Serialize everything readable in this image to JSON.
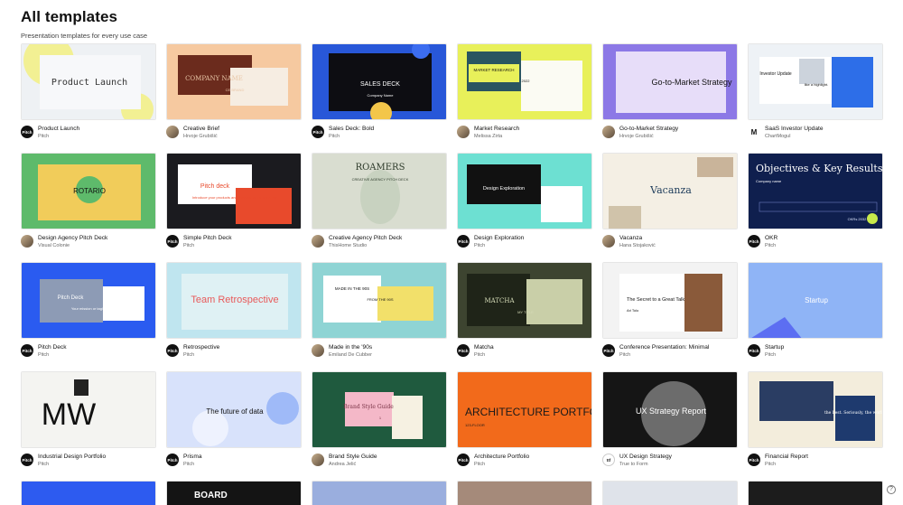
{
  "header": {
    "title": "All templates",
    "subtitle": "Presentation templates for every use case"
  },
  "help": {
    "icon": "question-icon",
    "glyph": "?"
  },
  "cards": [
    {
      "title": "Product Launch",
      "author": "Pitch",
      "avatar": "Pitch",
      "thumb_text": "Product Launch",
      "thumb_small": "",
      "thumb_extra": "",
      "bg": "#eef1f4",
      "accent": "#f3f06a"
    },
    {
      "title": "Creative Brief",
      "author": "Hrvoje Grubišić",
      "avatar": "",
      "thumb_text": "COMPANY NAME",
      "thumb_small": "CE BRAND",
      "thumb_extra": "",
      "bg": "#f6c9a0",
      "accent": "#6b2b1d"
    },
    {
      "title": "Sales Deck: Bold",
      "author": "Pitch",
      "avatar": "Pitch",
      "thumb_text": "SALES DECK",
      "thumb_small": "Company Name",
      "thumb_extra": "",
      "bg": "#2857d8",
      "accent": "#0d0d12"
    },
    {
      "title": "Market Research",
      "author": "Melissa Zirta",
      "avatar": "",
      "thumb_text": "MARKET RESEARCH",
      "thumb_small": "2022",
      "thumb_extra": "",
      "bg": "#e8f05a",
      "accent": "#2a5560"
    },
    {
      "title": "Go-to-Market Strategy",
      "author": "Hrvoje Grubišić",
      "avatar": "",
      "thumb_text": "Go-to-Market Strategy",
      "thumb_small": "",
      "thumb_extra": "",
      "bg": "#8c78e6",
      "accent": "#ffffff"
    },
    {
      "title": "SaaS Investor Update",
      "author": "ChartMogul",
      "avatar": "M",
      "thumb_text": "Investor Update",
      "thumb_small": "like a highlight.",
      "thumb_extra": "",
      "bg": "#eef2f6",
      "accent": "#2d6ee8"
    },
    {
      "title": "Design Agency Pitch Deck",
      "author": "Visual Colonie",
      "avatar": "",
      "thumb_text": "ROTARIO",
      "thumb_small": "",
      "thumb_extra": "",
      "bg": "#5eba6b",
      "accent": "#f1cc5a"
    },
    {
      "title": "Simple Pitch Deck",
      "author": "Pitch",
      "avatar": "Pitch",
      "thumb_text": "Pitch deck",
      "thumb_small": "Introduce your products and services to the customer",
      "thumb_extra": "",
      "bg": "#1b1b1f",
      "accent": "#e84a2c"
    },
    {
      "title": "Creative Agency Pitch Deck",
      "author": "ThisHome Studio",
      "avatar": "",
      "thumb_text": "ROAMERS",
      "thumb_small": "CREATIVE AGENCY PITCH DECK",
      "thumb_extra": "",
      "bg": "#d9ddd0",
      "accent": "#5a6a52"
    },
    {
      "title": "Design Exploration",
      "author": "Pitch",
      "avatar": "Pitch",
      "thumb_text": "Design Exploration",
      "thumb_small": "",
      "thumb_extra": "",
      "bg": "#6de0d2",
      "accent": "#111111"
    },
    {
      "title": "Vacanza",
      "author": "Hana Stojaković",
      "avatar": "",
      "thumb_text": "Vacanza",
      "thumb_small": "",
      "thumb_extra": "",
      "bg": "#f4efe4",
      "accent": "#1d3b5a"
    },
    {
      "title": "OKR",
      "author": "Pitch",
      "avatar": "Pitch",
      "thumb_text": "Objectives & Key Results",
      "thumb_small": "Company name",
      "thumb_extra": "OKRs 2032",
      "bg": "#0f1f4e",
      "accent": "#c8ea4b"
    },
    {
      "title": "Pitch Deck",
      "author": "Pitch",
      "avatar": "Pitch",
      "thumb_text": "Pitch Deck",
      "thumb_small": "Your mission or tagline",
      "thumb_extra": "",
      "bg": "#2a5bf0",
      "accent": "#ffffff"
    },
    {
      "title": "Retrospective",
      "author": "Pitch",
      "avatar": "Pitch",
      "thumb_text": "Team Retrospective",
      "thumb_small": "",
      "thumb_extra": "",
      "bg": "#bfe5ef",
      "accent": "#e85a5a"
    },
    {
      "title": "Made in the '90s",
      "author": "Emiland De Cubber",
      "avatar": "",
      "thumb_text": "MADE IN THE 90S",
      "thumb_small": "FROM THE 90S",
      "thumb_extra": "",
      "bg": "#8fd4d4",
      "accent": "#f2e06a"
    },
    {
      "title": "Matcha",
      "author": "Pitch",
      "avatar": "Pitch",
      "thumb_text": "MATCHA",
      "thumb_small": "MY TITLE",
      "thumb_extra": "",
      "bg": "#3d4430",
      "accent": "#c9cfa8"
    },
    {
      "title": "Conference Presentation: Minimal",
      "author": "Pitch",
      "avatar": "Pitch",
      "thumb_text": "The Secret to a Great Talk",
      "thumb_small": "Ari Tolo",
      "thumb_extra": "",
      "bg": "#f3f3f3",
      "accent": "#8a5a3a"
    },
    {
      "title": "Startup",
      "author": "Pitch",
      "avatar": "Pitch",
      "thumb_text": "Startup",
      "thumb_small": "",
      "thumb_extra": "",
      "bg": "#8fb4f6",
      "accent": "#5c6ef2"
    },
    {
      "title": "Industrial Design Portfolio",
      "author": "Pitch",
      "avatar": "Pitch",
      "thumb_text": "MW",
      "thumb_small": "",
      "thumb_extra": "",
      "bg": "#f4f4f1",
      "accent": "#111111"
    },
    {
      "title": "Prisma",
      "author": "Pitch",
      "avatar": "Pitch",
      "thumb_text": "The future of data",
      "thumb_small": "",
      "thumb_extra": "",
      "bg": "#d8e2fb",
      "accent": "#7aa0f6"
    },
    {
      "title": "Brand Style Guide",
      "author": "Andrea Jelić",
      "avatar": "",
      "thumb_text": "Brand Style Guide",
      "thumb_small": "1",
      "thumb_extra": "",
      "bg": "#1f5a3e",
      "accent": "#f4b8c8"
    },
    {
      "title": "Architecture Portfolio",
      "author": "Pitch",
      "avatar": "Pitch",
      "thumb_text": "ARCHITECTURE PORTFOLIO",
      "thumb_small": "123-FLOOR",
      "thumb_extra": "",
      "bg": "#f26a1b",
      "accent": "#1a1a1a"
    },
    {
      "title": "UX Design Strategy",
      "author": "True to Form",
      "avatar": "ttf",
      "thumb_text": "UX Strategy Report",
      "thumb_small": "",
      "thumb_extra": "",
      "bg": "#151515",
      "accent": "#6c6c6c"
    },
    {
      "title": "Financial Report",
      "author": "Pitch",
      "avatar": "Pitch",
      "thumb_text": "the best. Seriously, the world.",
      "thumb_small": "",
      "thumb_extra": "",
      "bg": "#f3eddc",
      "accent": "#1e3a6e"
    }
  ],
  "peek_row": [
    "#2d5bf0",
    "#141414",
    "#9aaede",
    "#a58a7a",
    "#dfe3ea",
    "#1c1c1c"
  ],
  "peek_text": [
    "",
    "BOARD",
    "",
    "",
    "",
    ""
  ]
}
